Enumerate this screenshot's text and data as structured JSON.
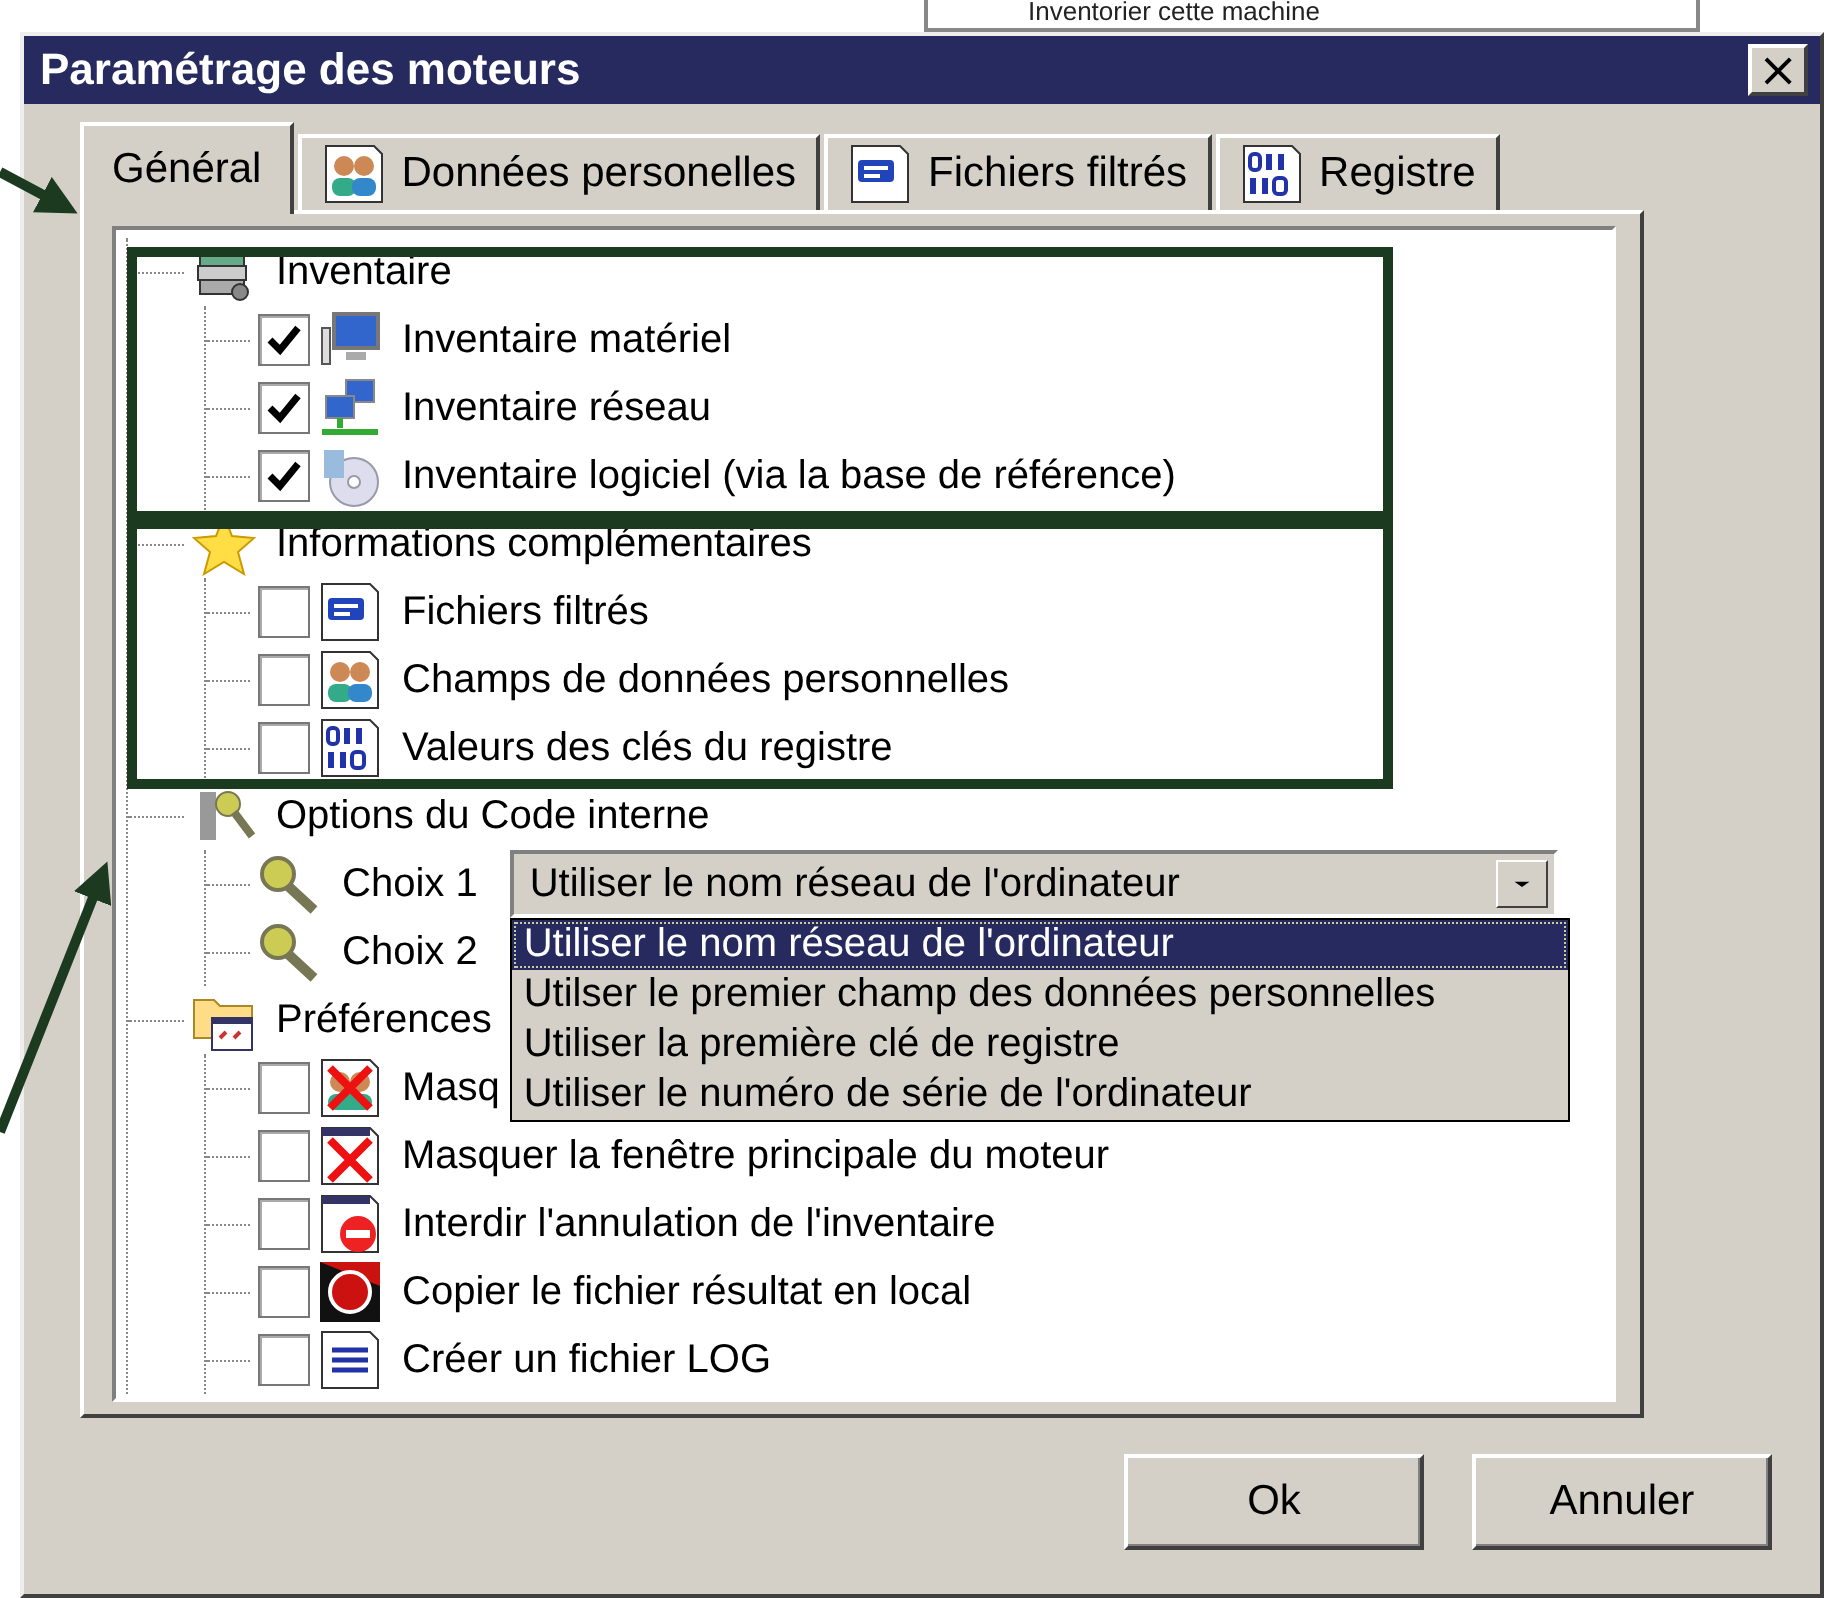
{
  "background_window": {
    "text": "Inventorier cette machine"
  },
  "window": {
    "title": "Paramétrage des moteurs",
    "close": "×"
  },
  "tabs": [
    {
      "label": "Général",
      "selected": true
    },
    {
      "label": "Données personelles",
      "selected": false
    },
    {
      "label": "Fichiers filtrés",
      "selected": false
    },
    {
      "label": "Registre",
      "selected": false
    }
  ],
  "tree": [
    {
      "kind": "group",
      "label": "Inventaire",
      "children": [
        {
          "kind": "check",
          "label": "Inventaire matériel",
          "checked": true
        },
        {
          "kind": "check",
          "label": "Inventaire réseau",
          "checked": true
        },
        {
          "kind": "check",
          "label": "Inventaire logiciel (via la base de référence)",
          "checked": true
        }
      ]
    },
    {
      "kind": "group",
      "label": "Informations complémentaires",
      "children": [
        {
          "kind": "check",
          "label": "Fichiers filtrés",
          "checked": false
        },
        {
          "kind": "check",
          "label": "Champs de données personnelles",
          "checked": false
        },
        {
          "kind": "check",
          "label": "Valeurs des clés du registre",
          "checked": false
        }
      ]
    },
    {
      "kind": "group",
      "label": "Options du Code interne",
      "children": [
        {
          "kind": "choice",
          "label": "Choix 1",
          "value": "Utiliser le nom réseau de l'ordinateur",
          "expanded": true,
          "options": [
            {
              "label": "Utiliser le nom réseau de l'ordinateur",
              "selected": true
            },
            {
              "label": "Utilser le premier champ des données personnelles",
              "selected": false
            },
            {
              "label": "Utiliser la première clé de registre",
              "selected": false
            },
            {
              "label": "Utiliser le numéro de série de l'ordinateur",
              "selected": false
            }
          ]
        },
        {
          "kind": "choice",
          "label": "Choix 2"
        }
      ]
    },
    {
      "kind": "group",
      "label": "Préférences",
      "children": [
        {
          "kind": "check",
          "label": "Masq",
          "checked": false
        },
        {
          "kind": "check",
          "label": "Masquer la fenêtre principale du moteur",
          "checked": false
        },
        {
          "kind": "check",
          "label": "Interdir l'annulation de l'inventaire",
          "checked": false
        },
        {
          "kind": "check",
          "label": "Copier le fichier résultat en local",
          "checked": false
        },
        {
          "kind": "check",
          "label": "Créer un fichier LOG",
          "checked": false
        }
      ]
    }
  ],
  "buttons": [
    "Ok",
    "Annuler"
  ]
}
